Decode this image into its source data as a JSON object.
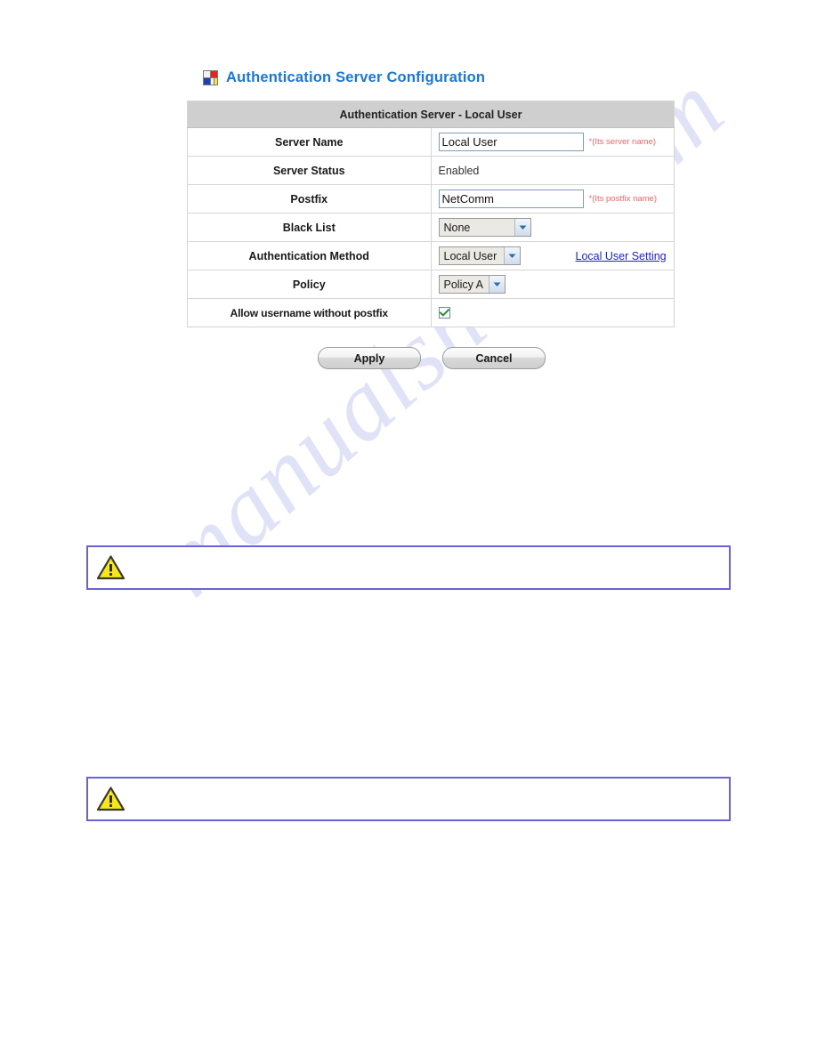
{
  "page": {
    "heading": "Authentication Server Configuration",
    "heading_icon": "mondrian-grid-icon",
    "watermark": "manualshive.com",
    "accent_color": "#1b77d4",
    "note_border_color": "#6a62d8",
    "hint_color": "#f4676b",
    "link_color": "#2222cc"
  },
  "table": {
    "header": "Authentication Server - Local User",
    "rows": [
      {
        "label": "Server Name",
        "type": "text",
        "value": "Local User",
        "hint": "*(Its server name)"
      },
      {
        "label": "Server Status",
        "type": "static",
        "value": "Enabled"
      },
      {
        "label": "Postfix",
        "type": "text",
        "value": "NetComm",
        "hint": "*(Its postfix name)"
      },
      {
        "label": "Black List",
        "type": "select",
        "value": "None"
      },
      {
        "label": "Authentication Method",
        "type": "select",
        "value": "Local User",
        "link": "Local User Setting"
      },
      {
        "label": "Policy",
        "type": "select",
        "value": "Policy A"
      },
      {
        "label": "Allow username without postfix",
        "type": "checkbox",
        "checked": true
      }
    ]
  },
  "buttons": {
    "apply": "Apply",
    "cancel": "Cancel"
  },
  "notes": [
    {
      "icon": "warning-triangle-icon",
      "text": ""
    },
    {
      "icon": "warning-triangle-icon",
      "text": ""
    }
  ]
}
